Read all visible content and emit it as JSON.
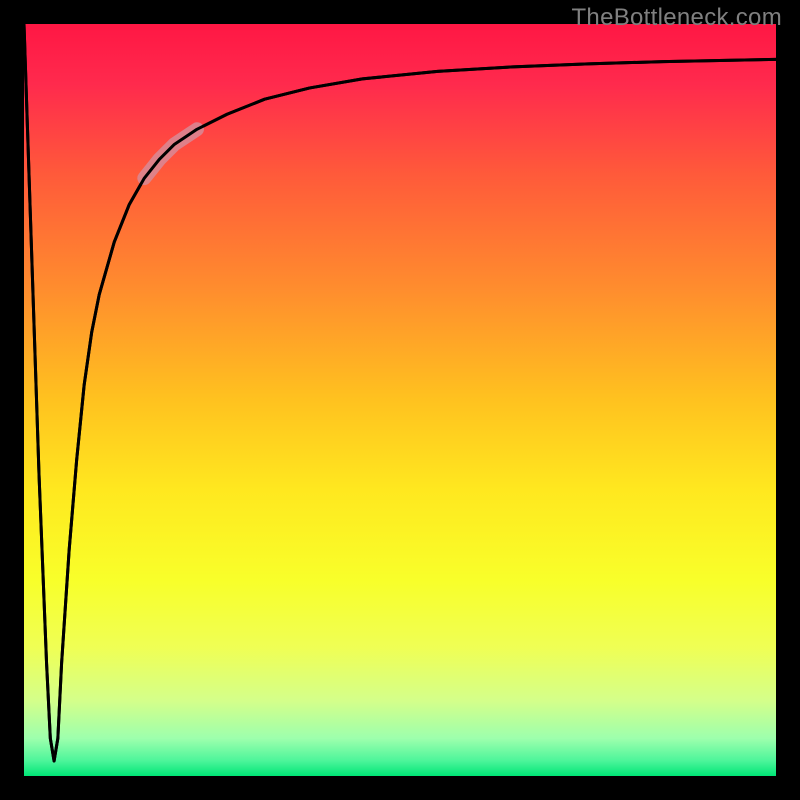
{
  "watermark": "TheBottleneck.com",
  "chart_data": {
    "type": "line",
    "title": "",
    "xlabel": "",
    "ylabel": "",
    "xlim": [
      0,
      100
    ],
    "ylim": [
      0,
      100
    ],
    "grid": false,
    "series": [
      {
        "name": "bottleneck-curve",
        "x": [
          0,
          1,
          2,
          3,
          3.5,
          4,
          4.5,
          5,
          6,
          7,
          8,
          9,
          10,
          12,
          14,
          16,
          18,
          20,
          23,
          27,
          32,
          38,
          45,
          55,
          65,
          75,
          85,
          95,
          100
        ],
        "values": [
          100,
          70,
          40,
          15,
          5,
          2,
          5,
          15,
          30,
          42,
          52,
          59,
          64,
          71,
          76,
          79.5,
          82,
          84,
          86,
          88,
          90,
          91.5,
          92.7,
          93.7,
          94.3,
          94.7,
          95,
          95.2,
          95.3
        ]
      }
    ],
    "highlight": {
      "name": "highlight-range",
      "x_start": 16,
      "x_end": 23
    },
    "background_gradient": {
      "top": "#FF1744",
      "middle": "#FFEB3B",
      "bottom": "#00E676"
    }
  }
}
